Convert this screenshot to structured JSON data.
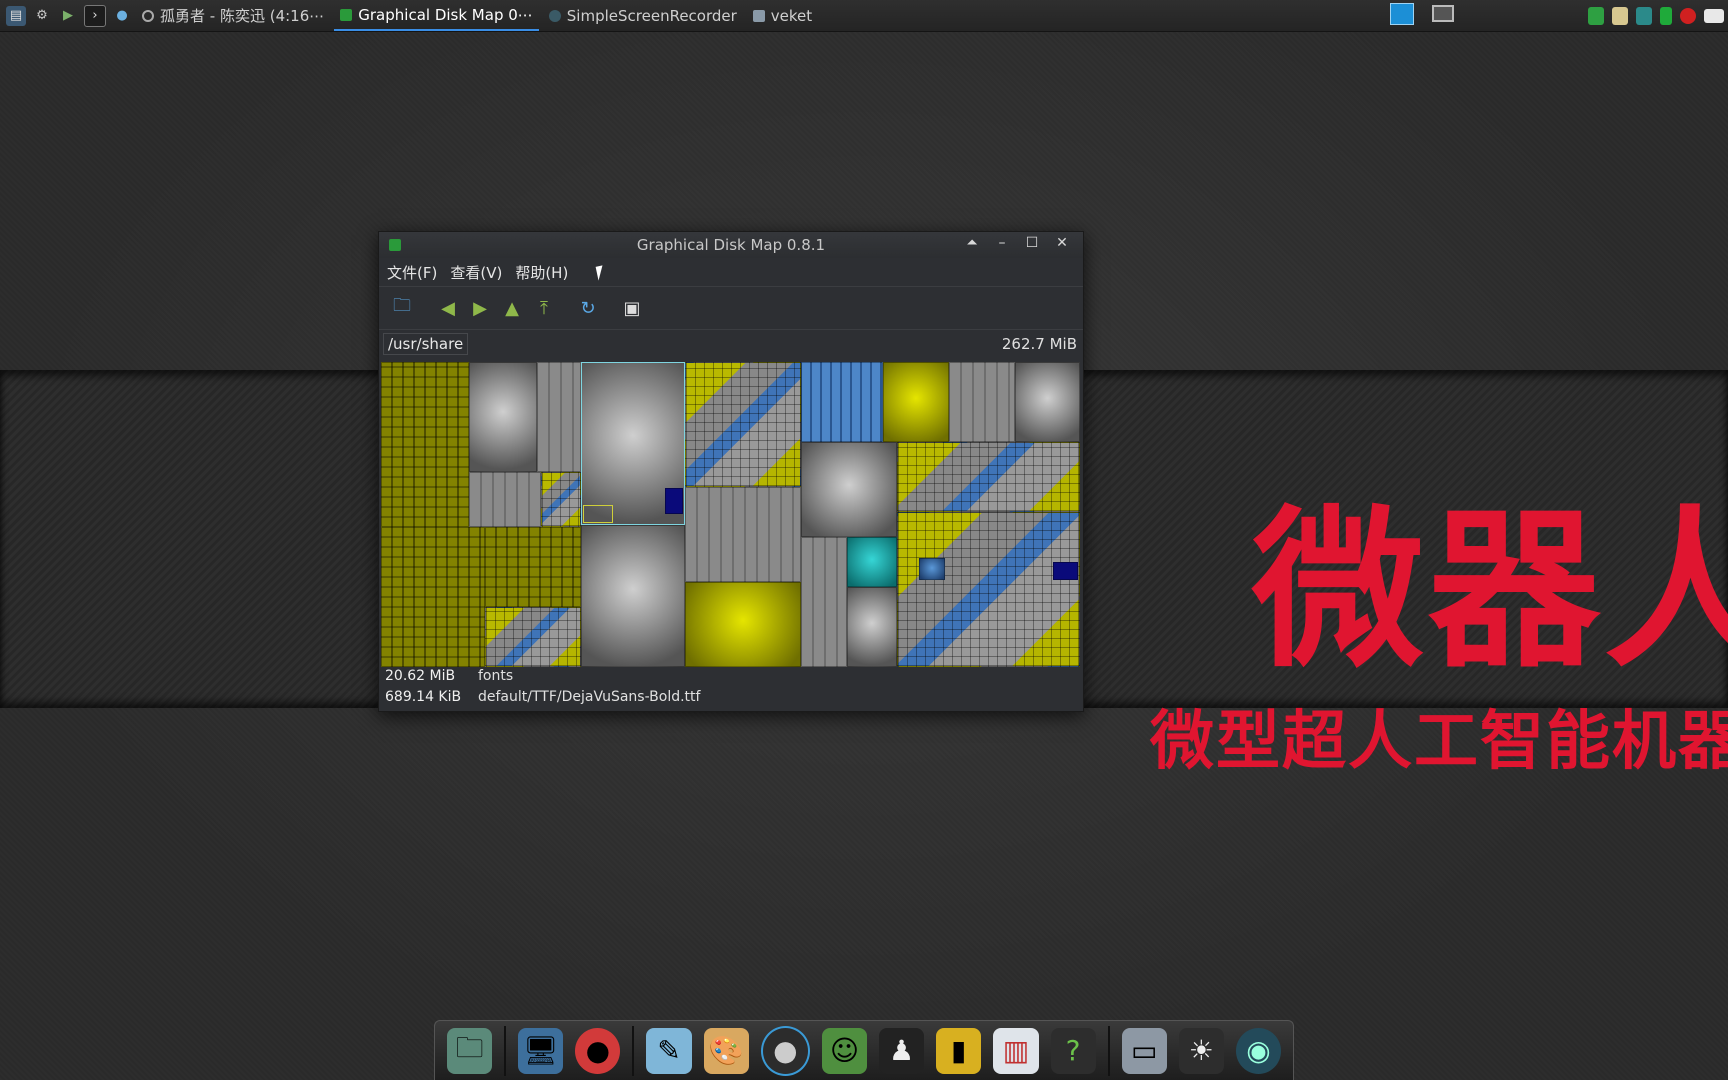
{
  "desktop": {
    "brand_big": "微器人",
    "brand_sub": "微型超人工智能机器"
  },
  "top_panel": {
    "quick_icons": [
      "system-monitor-icon",
      "settings-wrench-icon",
      "run-icon",
      "terminal-icon",
      "browser-globe-icon"
    ],
    "tasks": [
      {
        "label": "孤勇者 - 陈奕迅 (4:16⋯",
        "active": false
      },
      {
        "label": "Graphical Disk Map 0⋯",
        "active": true
      },
      {
        "label": "SimpleScreenRecorder",
        "active": false
      },
      {
        "label": "veket",
        "active": false
      }
    ],
    "tray_icons": [
      "shield-icon",
      "clipboard-icon",
      "network-icon",
      "battery-icon",
      "record-icon",
      "keyboard-icon"
    ]
  },
  "window": {
    "title": "Graphical Disk Map 0.8.1",
    "menu": [
      "文件(F)",
      "查看(V)",
      "帮助(H)"
    ],
    "toolbar": [
      "open-folder-icon",
      "back-icon",
      "forward-icon",
      "up-icon",
      "top-icon",
      "refresh-icon",
      "view-mode-icon"
    ],
    "path": "/usr/share",
    "total_size": "262.7 MiB",
    "status": [
      {
        "size": "20.62 MiB",
        "name": "fonts"
      },
      {
        "size": "689.14 KiB",
        "name": "default/TTF/DejaVuSans-Bold.ttf"
      }
    ]
  },
  "dock": {
    "icons": [
      "file-manager-icon",
      "monitor-icon",
      "pet-icon",
      "editor-icon",
      "paint-icon",
      "media-player-icon",
      "chat-users-icon",
      "penguin-icon",
      "book-icon",
      "chart-icon",
      "help-icon",
      "drive-icon",
      "brightness-icon",
      "camera-icon"
    ]
  }
}
